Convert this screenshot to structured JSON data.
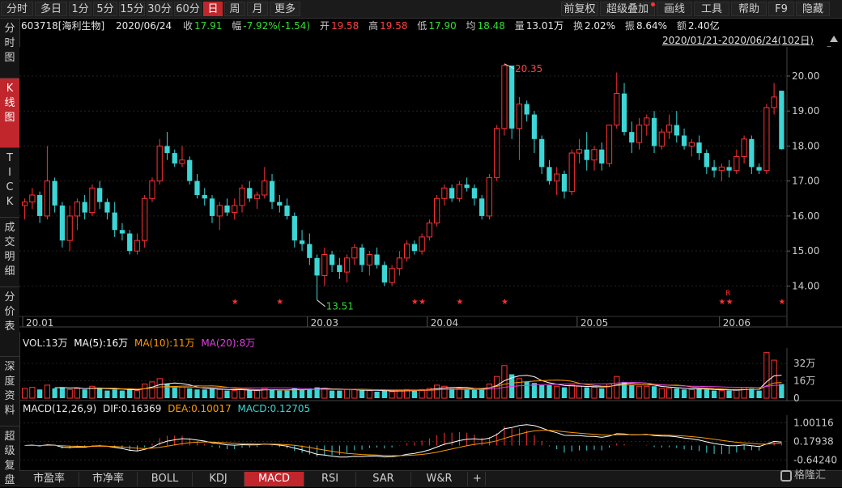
{
  "toolbar": {
    "periods": [
      {
        "label": "分时",
        "active": false
      },
      {
        "label": "多日",
        "active": false
      },
      {
        "label": "1分",
        "active": false
      },
      {
        "label": "5分",
        "active": false
      },
      {
        "label": "15分",
        "active": false
      },
      {
        "label": "30分",
        "active": false
      },
      {
        "label": "60分",
        "active": false
      },
      {
        "label": "日",
        "active": true
      },
      {
        "label": "周",
        "active": false
      },
      {
        "label": "月",
        "active": false
      },
      {
        "label": "更多",
        "active": false
      }
    ],
    "right": [
      "前复权",
      "超级叠加",
      "画线",
      "工具",
      "帮助",
      "F9",
      "隐藏"
    ]
  },
  "sidebar": [
    "分时图",
    "K线图",
    "TICK",
    "成交明细",
    "分价表",
    "深度资料",
    "超级复盘"
  ],
  "sidebar_active": 1,
  "quote": {
    "code_name": "603718[海利生物]",
    "date": "2020/06/24",
    "close_label": "收",
    "close": "17.91",
    "change_label": "幅",
    "change": "-7.92%(-1.54)",
    "open_label": "开",
    "open": "19.58",
    "high_label": "高",
    "high": "19.58",
    "low_label": "低",
    "low": "17.90",
    "avg_label": "均",
    "avg": "18.48",
    "volume_label": "量",
    "volume": "13.01万",
    "turnover_label": "换",
    "turnover": "2.02%",
    "amplitude_label": "振",
    "amplitude": "8.64%",
    "amount_label": "额",
    "amount": "2.40亿"
  },
  "range_text": "2020/01/21-2020/06/24(102日)",
  "main_chart": {
    "y_ticks": [
      "20.00",
      "19.00",
      "18.00",
      "17.00",
      "16.00",
      "15.00",
      "14.00"
    ],
    "x_ticks": [
      "20.01",
      "20.03",
      "20.04",
      "20.05",
      "20.06"
    ],
    "max_label": "20.35",
    "min_label": "13.51",
    "star_marker": "★",
    "r_marker": "R"
  },
  "vol_panel": {
    "title": "VOL:13万",
    "ma5": "MA(5):16万",
    "ma10": "MA(10):11万",
    "ma20": "MA(20):8万",
    "y_ticks": [
      "32万",
      "16万",
      "0"
    ]
  },
  "macd_panel": {
    "title": "MACD(12,26,9)",
    "dif": "DIF:0.16369",
    "dea": "DEA:0.10017",
    "macd": "MACD:0.12705",
    "y_ticks": [
      "1.00116",
      "0.17938",
      "-0.64240"
    ]
  },
  "bottom_tabs": [
    "市盈率",
    "市净率",
    "BOLL",
    "KDJ",
    "MACD",
    "RSI",
    "SAR",
    "W&R",
    "+"
  ],
  "bottom_active": 4,
  "watermark": "格隆汇",
  "colors": {
    "up": "#ff3232",
    "down": "#3cd6d6",
    "active": "#c0262c",
    "ma5": "#ffffff",
    "ma10": "#ff9900",
    "ma20": "#e040e0"
  },
  "chart_data": {
    "type": "candlestick",
    "candles": [
      [
        16.3,
        16.5,
        15.9,
        16.4
      ],
      [
        16.4,
        16.8,
        16.2,
        16.6
      ],
      [
        16.6,
        16.7,
        15.8,
        16.0
      ],
      [
        16.0,
        18.0,
        15.9,
        17.0
      ],
      [
        17.0,
        17.1,
        16.1,
        16.3
      ],
      [
        16.3,
        16.4,
        15.1,
        15.3
      ],
      [
        15.3,
        16.3,
        15.0,
        16.0
      ],
      [
        16.0,
        16.5,
        15.6,
        16.4
      ],
      [
        16.4,
        16.6,
        15.9,
        16.1
      ],
      [
        16.1,
        16.9,
        16.0,
        16.8
      ],
      [
        16.8,
        17.0,
        16.2,
        16.4
      ],
      [
        16.4,
        16.5,
        15.9,
        16.1
      ],
      [
        16.1,
        16.4,
        15.4,
        15.6
      ],
      [
        15.6,
        15.8,
        15.3,
        15.5
      ],
      [
        15.5,
        15.6,
        14.9,
        15.0
      ],
      [
        15.0,
        15.5,
        14.9,
        15.3
      ],
      [
        15.3,
        16.6,
        15.1,
        16.5
      ],
      [
        16.5,
        17.1,
        16.4,
        17.0
      ],
      [
        17.0,
        18.2,
        16.9,
        18.0
      ],
      [
        18.0,
        18.4,
        17.6,
        17.8
      ],
      [
        17.8,
        17.9,
        17.4,
        17.5
      ],
      [
        17.5,
        18.0,
        17.4,
        17.6
      ],
      [
        17.6,
        17.7,
        16.9,
        17.0
      ],
      [
        17.0,
        17.2,
        16.5,
        16.6
      ],
      [
        16.6,
        16.8,
        16.3,
        16.5
      ],
      [
        16.5,
        16.6,
        15.8,
        16.0
      ],
      [
        16.0,
        16.4,
        15.6,
        16.3
      ],
      [
        16.3,
        16.5,
        16.0,
        16.1
      ],
      [
        16.1,
        16.5,
        15.9,
        16.3
      ],
      [
        16.3,
        16.9,
        16.1,
        16.8
      ],
      [
        16.8,
        17.0,
        16.4,
        16.5
      ],
      [
        16.5,
        16.7,
        16.2,
        16.6
      ],
      [
        16.6,
        17.4,
        16.5,
        17.0
      ],
      [
        17.0,
        17.2,
        16.2,
        16.4
      ],
      [
        16.4,
        16.6,
        16.1,
        16.3
      ],
      [
        16.3,
        16.5,
        15.9,
        16.0
      ],
      [
        16.0,
        16.1,
        15.1,
        15.3
      ],
      [
        15.3,
        15.6,
        15.0,
        15.2
      ],
      [
        15.2,
        15.5,
        14.6,
        14.8
      ],
      [
        14.8,
        14.9,
        13.6,
        14.3
      ],
      [
        14.3,
        15.1,
        14.0,
        14.9
      ],
      [
        14.9,
        15.0,
        14.4,
        14.6
      ],
      [
        14.6,
        14.8,
        14.2,
        14.4
      ],
      [
        14.4,
        14.9,
        14.1,
        14.8
      ],
      [
        14.8,
        15.2,
        14.6,
        15.1
      ],
      [
        15.1,
        15.2,
        14.4,
        14.6
      ],
      [
        14.6,
        15.0,
        14.3,
        14.9
      ],
      [
        14.9,
        15.1,
        14.5,
        14.6
      ],
      [
        14.6,
        14.7,
        14.0,
        14.1
      ],
      [
        14.1,
        14.6,
        14.0,
        14.5
      ],
      [
        14.5,
        15.0,
        14.3,
        14.8
      ],
      [
        14.8,
        15.3,
        14.7,
        15.2
      ],
      [
        15.2,
        15.3,
        14.9,
        15.0
      ],
      [
        15.0,
        15.5,
        14.9,
        15.4
      ],
      [
        15.4,
        15.9,
        15.3,
        15.8
      ],
      [
        15.8,
        16.6,
        15.7,
        16.5
      ],
      [
        16.5,
        16.9,
        16.3,
        16.8
      ],
      [
        16.8,
        16.9,
        16.4,
        16.5
      ],
      [
        16.5,
        17.0,
        16.4,
        16.9
      ],
      [
        16.9,
        17.1,
        16.7,
        16.8
      ],
      [
        16.8,
        16.9,
        16.3,
        16.5
      ],
      [
        16.5,
        16.6,
        15.9,
        16.0
      ],
      [
        16.0,
        17.2,
        15.9,
        17.1
      ],
      [
        17.1,
        18.6,
        17.0,
        18.5
      ],
      [
        18.5,
        20.35,
        18.3,
        20.3
      ],
      [
        20.3,
        20.3,
        18.2,
        18.5
      ],
      [
        18.5,
        19.4,
        17.6,
        19.2
      ],
      [
        19.2,
        19.3,
        18.7,
        18.9
      ],
      [
        18.9,
        19.0,
        17.8,
        18.2
      ],
      [
        18.2,
        18.3,
        17.2,
        17.4
      ],
      [
        17.4,
        17.6,
        16.9,
        17.0
      ],
      [
        17.0,
        17.4,
        16.6,
        17.2
      ],
      [
        17.2,
        17.3,
        16.5,
        16.7
      ],
      [
        16.7,
        17.9,
        16.6,
        17.8
      ],
      [
        17.8,
        18.2,
        17.5,
        17.9
      ],
      [
        17.9,
        18.4,
        17.3,
        17.6
      ],
      [
        17.6,
        18.0,
        17.3,
        17.9
      ],
      [
        17.9,
        18.1,
        17.3,
        17.5
      ],
      [
        17.5,
        18.6,
        17.4,
        18.6
      ],
      [
        18.6,
        20.1,
        18.5,
        19.5
      ],
      [
        19.5,
        19.8,
        18.3,
        18.4
      ],
      [
        18.4,
        18.7,
        17.8,
        18.1
      ],
      [
        18.1,
        18.8,
        17.9,
        18.6
      ],
      [
        18.6,
        18.9,
        18.3,
        18.8
      ],
      [
        18.8,
        19.0,
        17.8,
        18.0
      ],
      [
        18.0,
        18.5,
        17.9,
        18.4
      ],
      [
        18.4,
        18.9,
        18.2,
        18.6
      ],
      [
        18.6,
        19.0,
        18.1,
        18.3
      ],
      [
        18.3,
        18.5,
        17.9,
        18.0
      ],
      [
        18.0,
        18.2,
        17.7,
        18.1
      ],
      [
        18.1,
        18.3,
        17.6,
        17.8
      ],
      [
        17.8,
        17.9,
        17.2,
        17.4
      ],
      [
        17.4,
        17.6,
        17.1,
        17.3
      ],
      [
        17.3,
        17.5,
        17.0,
        17.4
      ],
      [
        17.4,
        17.6,
        17.1,
        17.3
      ],
      [
        17.3,
        17.9,
        17.2,
        17.7
      ],
      [
        17.7,
        18.3,
        17.5,
        18.2
      ],
      [
        18.2,
        18.3,
        17.2,
        17.4
      ],
      [
        17.4,
        17.5,
        17.2,
        17.3
      ],
      [
        17.3,
        19.2,
        17.2,
        19.1
      ],
      [
        19.1,
        19.8,
        18.9,
        19.4
      ],
      [
        19.58,
        19.58,
        17.9,
        17.91
      ]
    ],
    "volume_wan": [
      9,
      10,
      8,
      12,
      9,
      10,
      8,
      9,
      8,
      11,
      9,
      7,
      8,
      7,
      9,
      7,
      13,
      15,
      18,
      13,
      11,
      10,
      9,
      8,
      8,
      9,
      8,
      7,
      7,
      8,
      7,
      7,
      9,
      8,
      7,
      7,
      9,
      8,
      9,
      10,
      9,
      7,
      7,
      8,
      8,
      7,
      7,
      6,
      7,
      6,
      7,
      8,
      7,
      8,
      9,
      12,
      11,
      9,
      9,
      8,
      8,
      9,
      13,
      20,
      30,
      22,
      18,
      15,
      14,
      12,
      12,
      11,
      10,
      12,
      11,
      10,
      10,
      9,
      13,
      20,
      15,
      12,
      11,
      11,
      11,
      9,
      9,
      9,
      8,
      8,
      9,
      8,
      7,
      7,
      7,
      8,
      10,
      9,
      7,
      42,
      35,
      13
    ],
    "y_range": [
      13.2,
      20.6
    ],
    "macd_range": [
      -0.95,
      1.2
    ]
  }
}
